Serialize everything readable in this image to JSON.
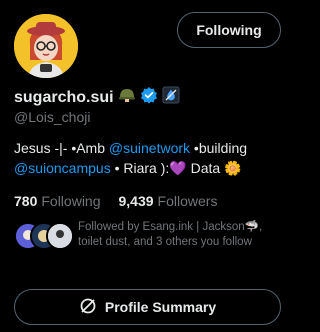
{
  "profile": {
    "display_name": "sugarcho.sui",
    "handle": "@Lois_choji",
    "follow_button_label": "Following"
  },
  "bio": {
    "part1": "Jesus -|- •Amb ",
    "mention1": "@suinetwork",
    "part2": " •building ",
    "mention2": "@suioncampus",
    "part3": " • Riara ):",
    "emoji_heart": "💜",
    "part4": " Data ",
    "emoji_flower": "🌼"
  },
  "stats": {
    "following_count": "780",
    "following_label": "Following",
    "followers_count": "9,439",
    "followers_label": "Followers"
  },
  "followed_by": {
    "text": "Followed by Esang.ink | Jackson🦈, toilet dust, and 3 others you follow"
  },
  "summary_button": {
    "label": "Profile Summary"
  },
  "colors": {
    "background": "#000000",
    "text": "#e7e9ea",
    "muted": "#71767b",
    "link": "#1d9bf0",
    "border": "#536471",
    "verified": "#1d9bf0"
  }
}
